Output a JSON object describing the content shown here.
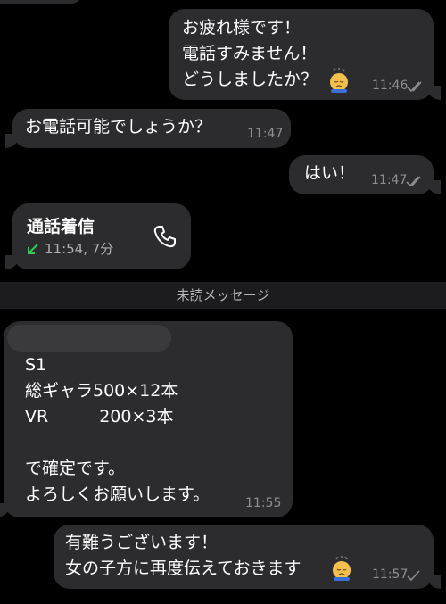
{
  "messages": [
    {
      "id": "m1",
      "direction": "outgoing",
      "text": "お疲れ様です！\n電話すみません！\nどうしましたか？",
      "emoji": "sweat-face",
      "time": "11:46",
      "status": "read"
    },
    {
      "id": "m2",
      "direction": "incoming",
      "text": "お電話可能でしょうか？",
      "time": "11:47"
    },
    {
      "id": "m3",
      "direction": "outgoing",
      "text": "はい！",
      "time": "11:47",
      "status": "read"
    },
    {
      "id": "m4",
      "direction": "incoming",
      "type": "call",
      "title": "通話着信",
      "meta": "11:54, 7分",
      "icon": "phone-icon"
    },
    {
      "id": "m5",
      "direction": "incoming",
      "text": "S1\n総ギャラ500×12本\nVR　　　200×3本\n\nで確定です。\nよろしくお願いします。",
      "time": "11:55"
    },
    {
      "id": "m6",
      "direction": "outgoing",
      "text": "有難うございます！\n女の子方に再度伝えておきます",
      "emoji": "sweat-face",
      "time": "11:57",
      "status": "sent"
    }
  ],
  "unread_divider": "未読メッセージ",
  "colors": {
    "background": "#000000",
    "bubble": "#2c2c2e",
    "time": "#8e8e93",
    "call_green": "#34c759"
  }
}
